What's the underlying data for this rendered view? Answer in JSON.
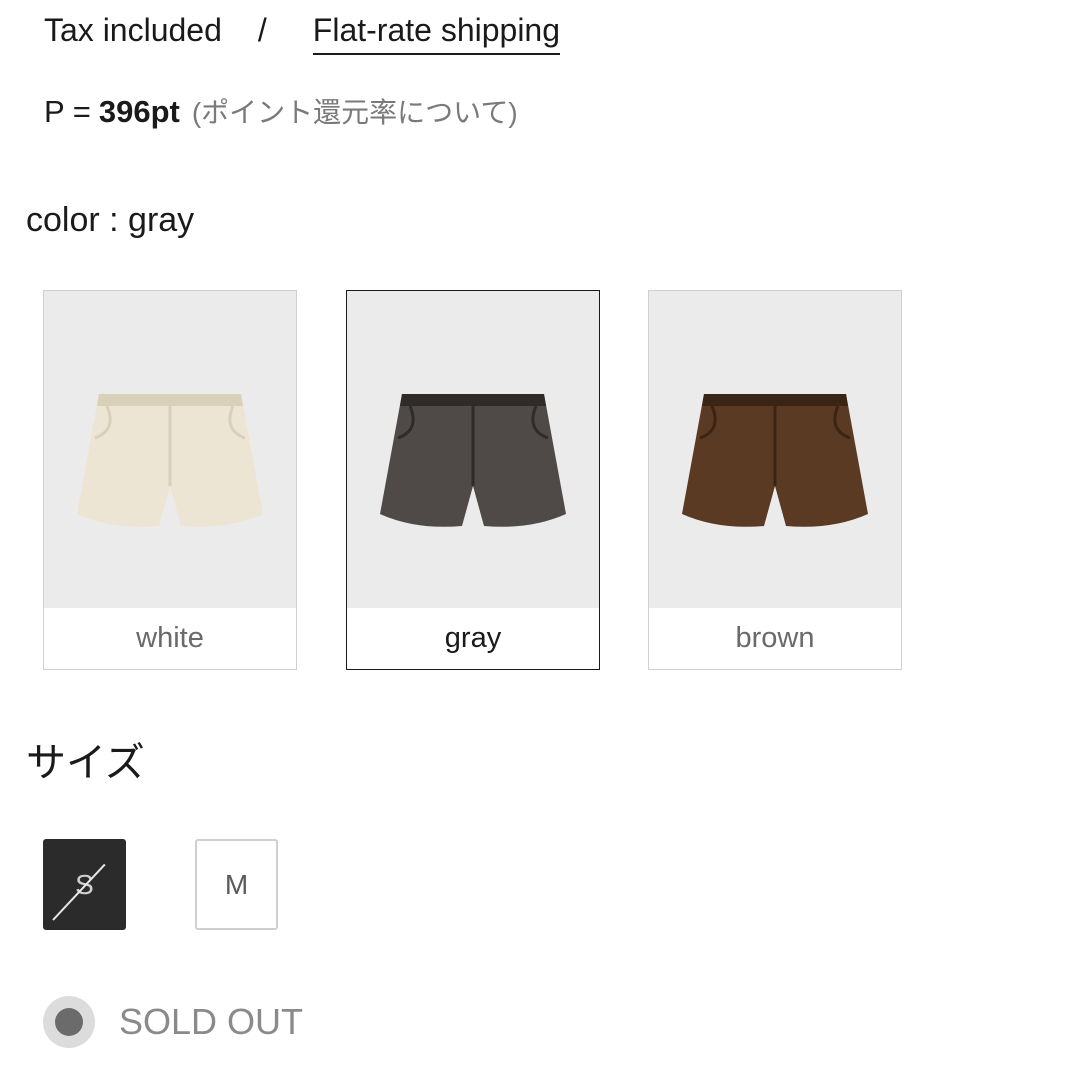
{
  "pricing": {
    "tax_label": "Tax included",
    "separator": "/",
    "shipping_label": "Flat-rate shipping"
  },
  "points": {
    "prefix": "P =",
    "value": "396pt",
    "note": "(ポイント還元率について)"
  },
  "color": {
    "label": "color : gray",
    "swatches": [
      {
        "label": "white",
        "fill": "#ece5d3",
        "shade": "#d9d0ba",
        "selected": false
      },
      {
        "label": "gray",
        "fill": "#4f4a47",
        "shade": "#2f2b29",
        "selected": true
      },
      {
        "label": "brown",
        "fill": "#5a3a22",
        "shade": "#3a2414",
        "selected": false
      }
    ]
  },
  "size": {
    "heading": "サイズ",
    "options": [
      {
        "label": "S",
        "sold_out": true
      },
      {
        "label": "M",
        "sold_out": false
      }
    ]
  },
  "stock": {
    "status": "SOLD OUT",
    "icon": "stock-status-dot-icon"
  }
}
